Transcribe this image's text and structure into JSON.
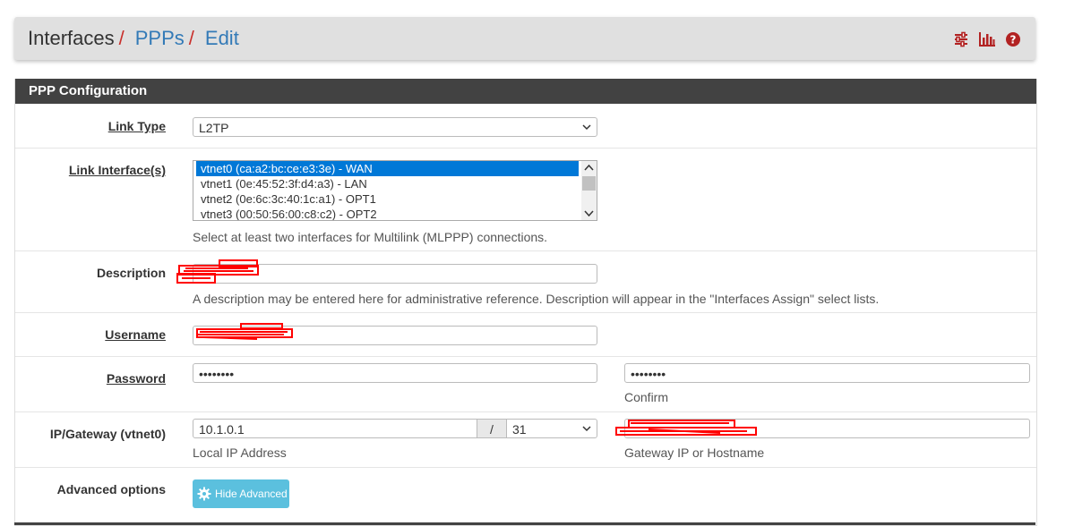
{
  "breadcrumb": {
    "root": "Interfaces",
    "sep": "/",
    "level2": "PPPs",
    "level3": "Edit"
  },
  "header_icons": [
    "sliders-icon",
    "bar-chart-icon",
    "help-icon"
  ],
  "colors": {
    "accent_red": "#c9302c",
    "link_blue": "#337ab7",
    "panel_heading": "#424242",
    "info_button": "#5bc0de"
  },
  "panel": {
    "title": "PPP Configuration"
  },
  "link_type": {
    "label": "Link Type",
    "value": "L2TP"
  },
  "link_interfaces": {
    "label": "Link Interface(s)",
    "options": [
      "vtnet0 (ca:a2:bc:ce:e3:3e) - WAN",
      "vtnet1 (0e:45:52:3f:d4:a3) - LAN",
      "vtnet2 (0e:6c:3c:40:1c:a1) - OPT1",
      "vtnet3 (00:50:56:00:c8:c2) - OPT2"
    ],
    "selected_index": 0,
    "help": "Select at least two interfaces for Multilink (MLPPP) connections."
  },
  "description": {
    "label": "Description",
    "help": "A description may be entered here for administrative reference. Description will appear in the \"Interfaces Assign\" select lists."
  },
  "username": {
    "label": "Username"
  },
  "password": {
    "label": "Password",
    "value": "••••••••",
    "confirm_value": "••••••••",
    "confirm_help": "Confirm"
  },
  "ip_gateway": {
    "label": "IP/Gateway (vtnet0)",
    "local_ip": "10.1.0.1",
    "slash": "/",
    "prefix": "31",
    "local_help": "Local IP Address",
    "gateway_help": "Gateway IP or Hostname"
  },
  "advanced": {
    "label": "Advanced options",
    "button": "Hide Advanced"
  }
}
